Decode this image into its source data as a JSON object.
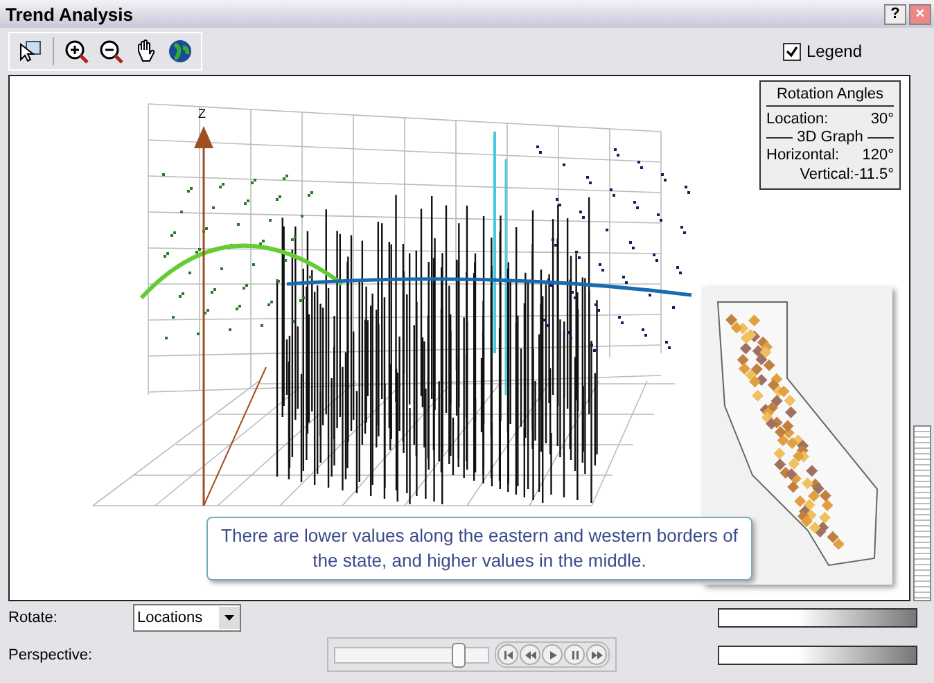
{
  "window": {
    "title": "Trend Analysis",
    "buttons": [
      "?",
      "×"
    ]
  },
  "toolbar": {
    "legend": {
      "label": "Legend",
      "checked": true
    }
  },
  "plot": {
    "axis_label": "Z",
    "rotation_angles": {
      "title": "Rotation Angles",
      "location_label": "Location:",
      "location_value": "30°",
      "section": "3D Graph",
      "horizontal_label": "Horizontal:",
      "horizontal_value": "120°",
      "vertical_label": "Vertical:",
      "vertical_value": "-11.5°"
    },
    "callout": "There are lower values along the eastern and western borders of the state, and higher values in the middle."
  },
  "controls": {
    "rotate_label": "Rotate:",
    "rotate_value": "Locations",
    "perspective": {
      "label": "Perspective:",
      "level": 0.82
    }
  }
}
